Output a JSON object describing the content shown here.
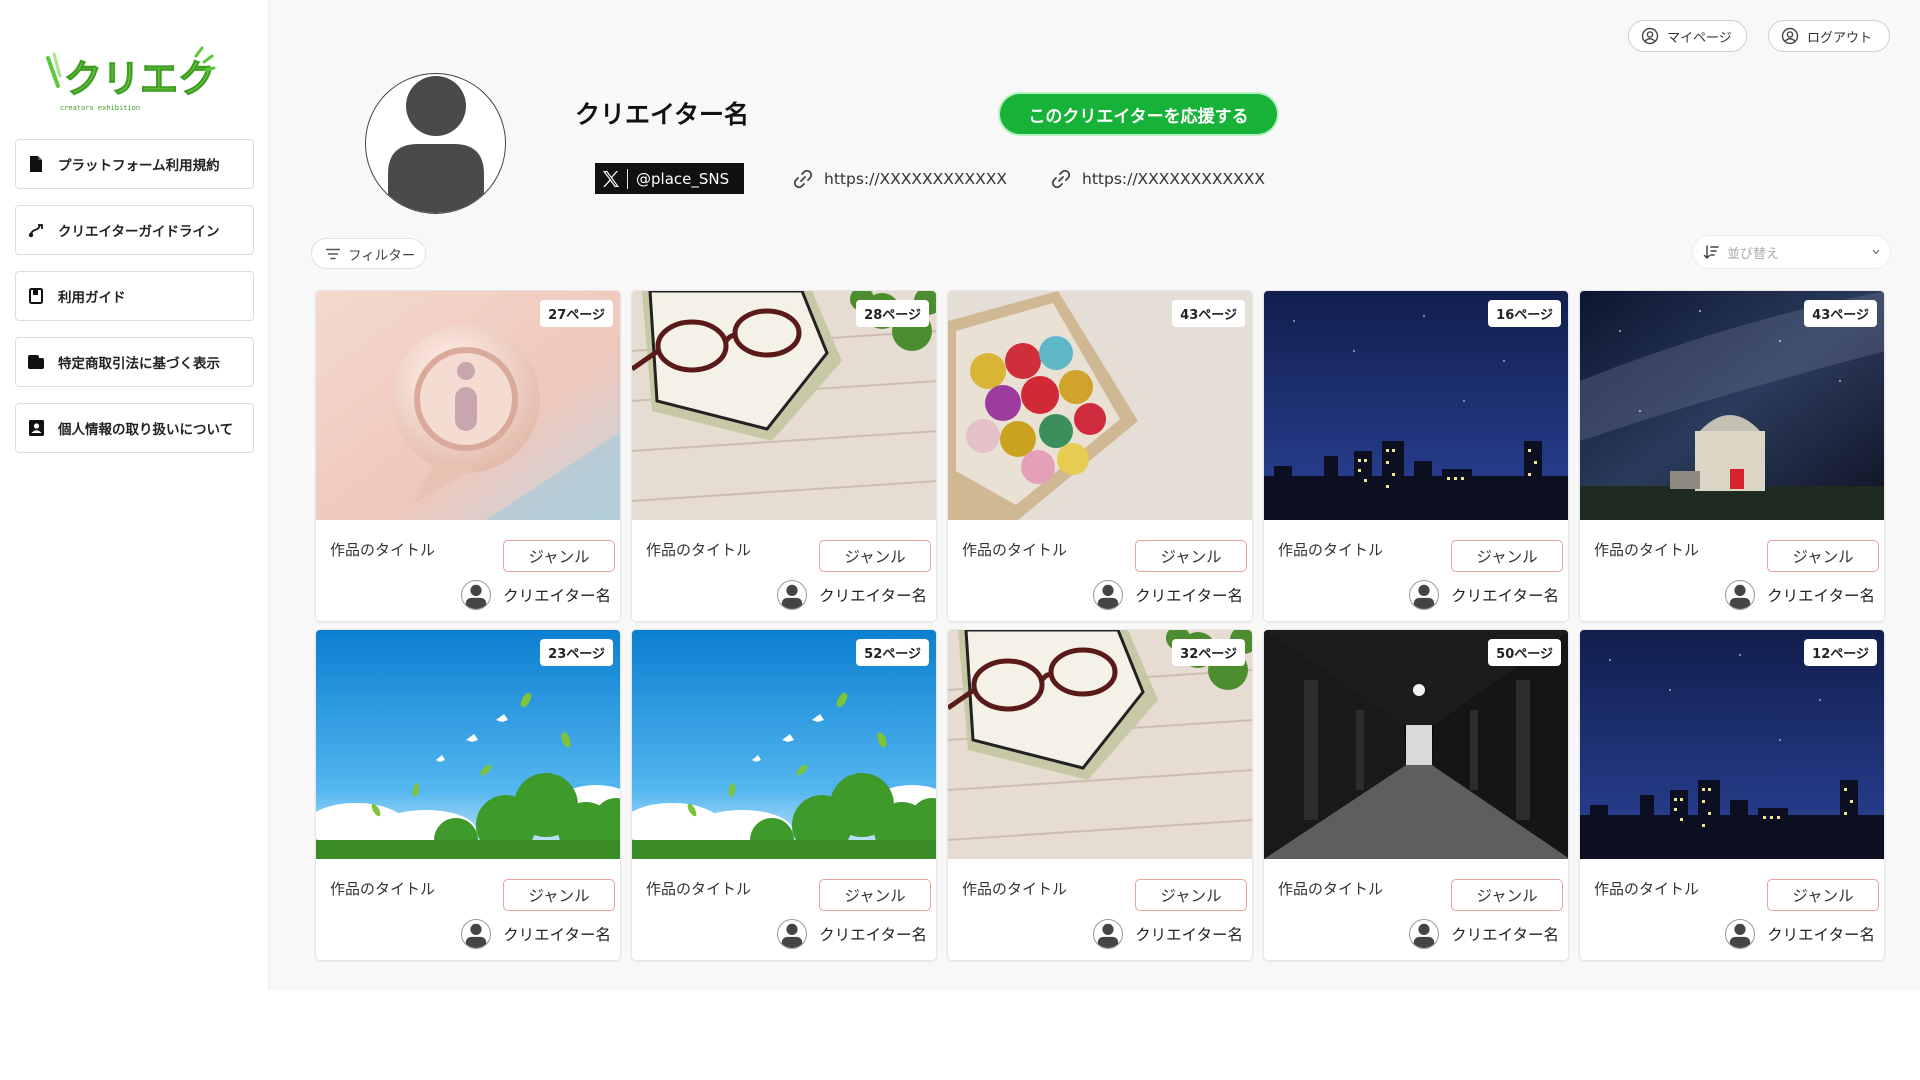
{
  "sidebar": {
    "logo_text": "クリエク",
    "logo_subtext": "creators exhibition",
    "items": [
      {
        "label": "プラットフォーム利用規約",
        "icon": "document-icon"
      },
      {
        "label": "クリエイターガイドライン",
        "icon": "route-icon"
      },
      {
        "label": "利用ガイド",
        "icon": "book-icon"
      },
      {
        "label": "特定商取引法に基づく表示",
        "icon": "folder-icon"
      },
      {
        "label": "個人情報の取り扱いについて",
        "icon": "contact-card-icon"
      }
    ]
  },
  "header": {
    "mypage_label": "マイページ",
    "logout_label": "ログアウト"
  },
  "profile": {
    "name": "クリエイター名",
    "support_label": "このクリエイターを応援する",
    "sns_handle": "@place_SNS",
    "link1": "https://XXXXXXXXXXXX",
    "link2": "https://XXXXXXXXXXXX"
  },
  "toolbar": {
    "filter_label": "フィルター",
    "sort_placeholder": "並び替え"
  },
  "works": [
    {
      "title": "作品のタイトル",
      "genre": "ジャンル",
      "creator": "クリエイター名",
      "pages": "27ページ",
      "image": "info-bubble-3d"
    },
    {
      "title": "作品のタイトル",
      "genre": "ジャンル",
      "creator": "クリエイター名",
      "pages": "28ページ",
      "image": "glasses-on-book"
    },
    {
      "title": "作品のタイトル",
      "genre": "ジャンル",
      "creator": "クリエイター名",
      "pages": "43ページ",
      "image": "heart-chocolates"
    },
    {
      "title": "作品のタイトル",
      "genre": "ジャンル",
      "creator": "クリエイター名",
      "pages": "16ページ",
      "image": "night-city"
    },
    {
      "title": "作品のタイトル",
      "genre": "ジャンル",
      "creator": "クリエイター名",
      "pages": "43ページ",
      "image": "observatory-milky-way"
    },
    {
      "title": "作品のタイトル",
      "genre": "ジャンル",
      "creator": "クリエイター名",
      "pages": "23ページ",
      "image": "blue-sky-leaves"
    },
    {
      "title": "作品のタイトル",
      "genre": "ジャンル",
      "creator": "クリエイター名",
      "pages": "52ページ",
      "image": "blue-sky-leaves"
    },
    {
      "title": "作品のタイトル",
      "genre": "ジャンル",
      "creator": "クリエイター名",
      "pages": "32ページ",
      "image": "glasses-on-book"
    },
    {
      "title": "作品のタイトル",
      "genre": "ジャンル",
      "creator": "クリエイター名",
      "pages": "50ページ",
      "image": "dark-corridor"
    },
    {
      "title": "作品のタイトル",
      "genre": "ジャンル",
      "creator": "クリエイター名",
      "pages": "12ページ",
      "image": "night-city"
    }
  ],
  "colors": {
    "support_green": "#16b338",
    "genre_border": "#e8a39a",
    "logo_green": "#7ed957"
  }
}
